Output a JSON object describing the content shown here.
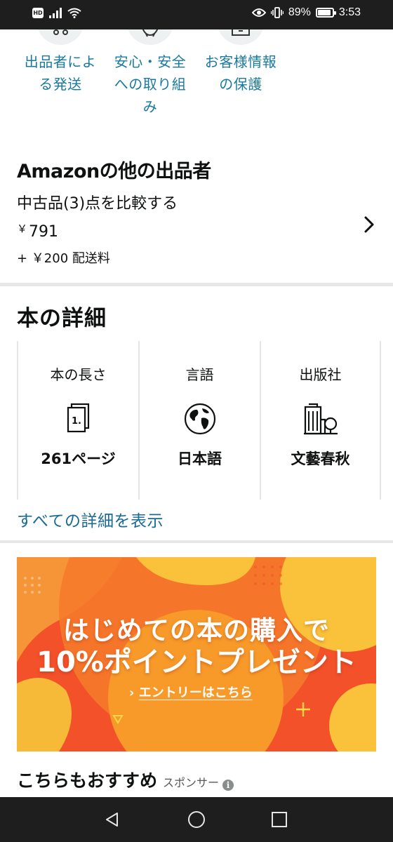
{
  "status_bar": {
    "hd_label": "HD",
    "battery_percent_label": "89%",
    "battery_level": 0.89,
    "time": "3:53"
  },
  "trust_items": [
    {
      "label": "出品者による発送",
      "icon": "truck-icon"
    },
    {
      "label": "安心・安全への取り組み",
      "icon": "badge-icon"
    },
    {
      "label": "お客様情報の保護",
      "icon": "lock-card-icon"
    }
  ],
  "other_sellers": {
    "title": "Amazonの他の出品者",
    "compare_text": "中古品(3)点を比較する",
    "price_symbol": "￥",
    "price_value": "791",
    "shipping_text": "+ ￥200 配送料"
  },
  "book_details": {
    "title": "本の詳細",
    "cards": [
      {
        "label": "本の長さ",
        "value": "261ページ",
        "icon": "page-count-icon",
        "icon_text": "1."
      },
      {
        "label": "言語",
        "value": "日本語",
        "icon": "globe-icon"
      },
      {
        "label": "出版社",
        "value": "文藝春秋",
        "icon": "building-icon"
      }
    ],
    "see_all_link": "すべての詳細を表示"
  },
  "promo_banner": {
    "line1": "はじめての本の購入で",
    "line2": "10%ポイントプレゼント",
    "entry_prefix": "›",
    "entry_link": "エントリーはこちら"
  },
  "recommended": {
    "title": "こちらもおすすめ",
    "sponsor_label": "スポンサー",
    "info_glyph": "i"
  },
  "nav_bar": {
    "buttons": [
      "back-icon",
      "home-icon",
      "recents-icon"
    ]
  },
  "colors": {
    "link": "#1a7a9e",
    "banner_orange": "#f2512a",
    "banner_yellow": "#f7c23a",
    "divider": "#e6e8e8"
  }
}
